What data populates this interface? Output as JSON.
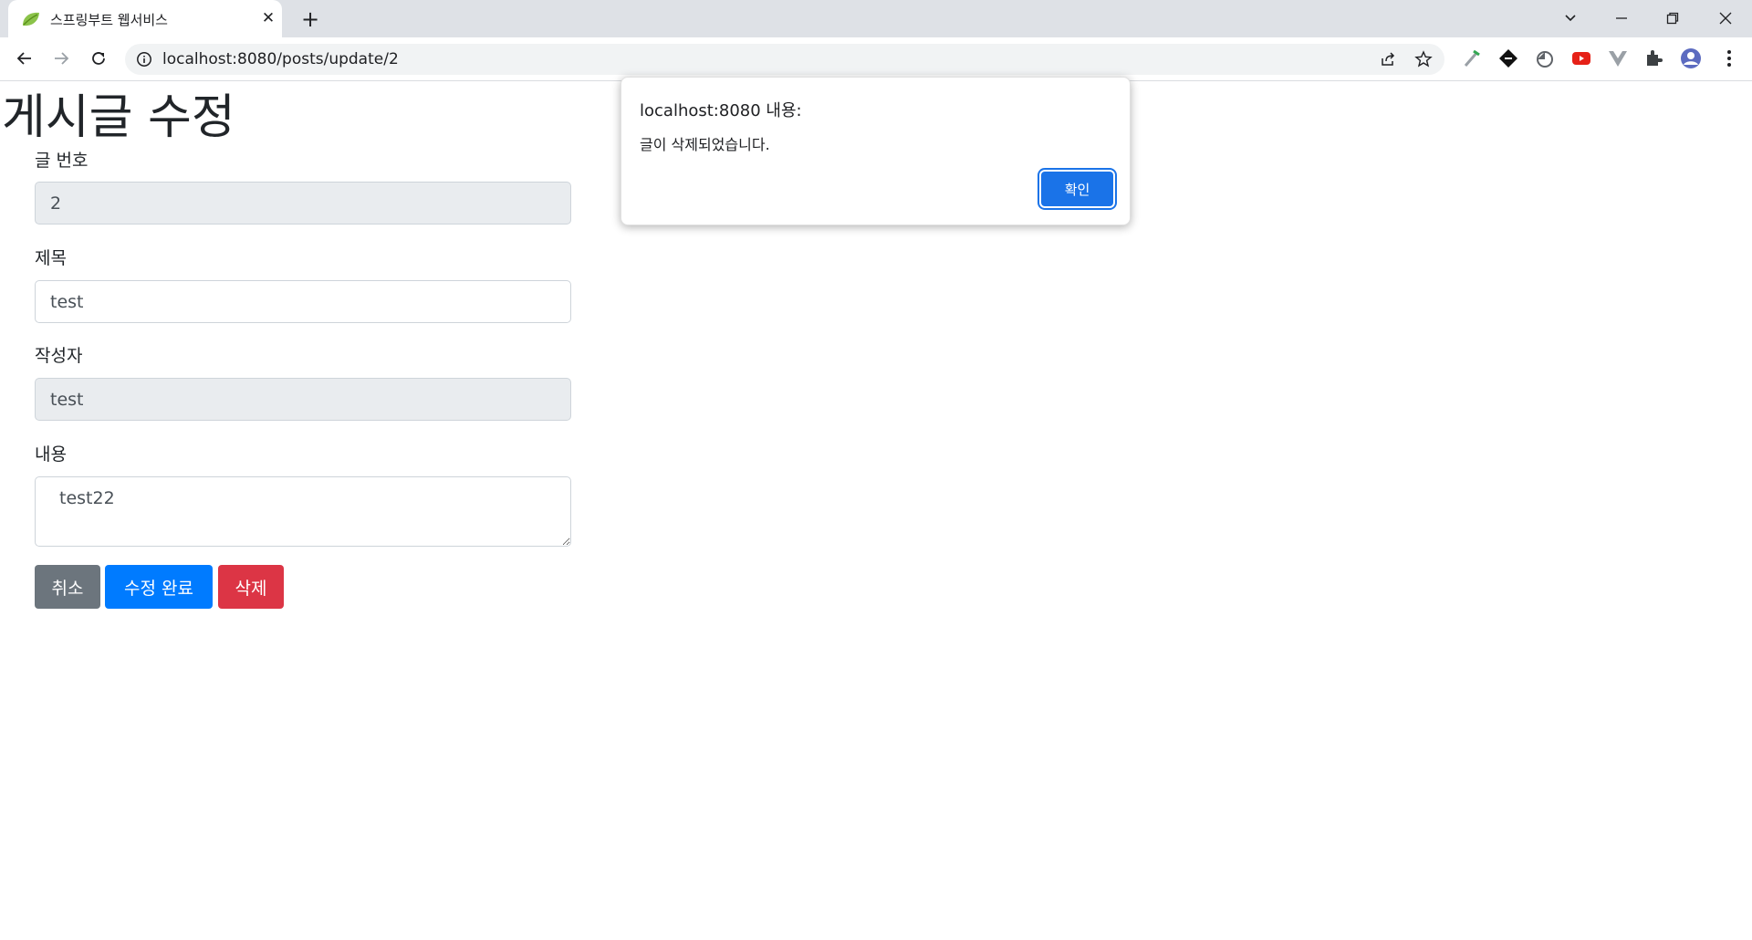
{
  "browser": {
    "tab_title": "스프링부트 웹서비스",
    "new_tab": "+",
    "close_tab": "✕",
    "url": "localhost:8080/posts/update/2"
  },
  "page": {
    "title": "게시글 수정",
    "fields": {
      "id_label": "글 번호",
      "id_value": "2",
      "title_label": "제목",
      "title_value": "test",
      "author_label": "작성자",
      "author_value": "test",
      "content_label": "내용",
      "content_value": "test22"
    },
    "buttons": {
      "cancel": "취소",
      "save": "수정 완료",
      "delete": "삭제"
    }
  },
  "dialog": {
    "origin": "localhost:8080 내용:",
    "message": "글이 삭제되었습니다.",
    "ok": "확인"
  },
  "colors": {
    "primary": "#007bff",
    "secondary": "#6c757d",
    "danger": "#dc3545",
    "dialog_accent": "#1a73e8"
  }
}
